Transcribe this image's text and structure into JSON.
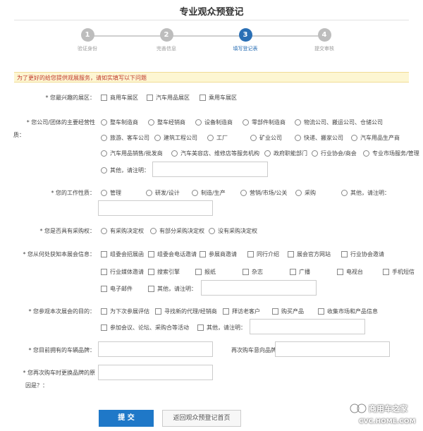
{
  "title": "专业观众预登记",
  "steps": [
    {
      "num": "1",
      "label": "验证身份"
    },
    {
      "num": "2",
      "label": "完善信息"
    },
    {
      "num": "3",
      "label": "填写登记表"
    },
    {
      "num": "4",
      "label": "提交审核"
    }
  ],
  "notice": "为了更好的给您提供观展服务，请如实填写以下问题",
  "q1": {
    "label": "* 您最兴趣的展区：",
    "options": [
      "商用车展区",
      "汽车用品展区",
      "乘用车展区"
    ]
  },
  "q2": {
    "label1": "* 您公司/团体的主要经营性",
    "label2": "质：",
    "row1": [
      "整车制造商",
      "整车经销商",
      "设备制造商",
      "零部件制造商",
      "物流公司、搬运公司、仓储公司"
    ],
    "row2": [
      "旅游、客车公司",
      "建筑工程公司",
      "工厂",
      "矿业公司",
      "快递、搬家公司",
      "汽车用品生产商"
    ],
    "row3": [
      "汽车用品销售/批发商",
      "汽车美容店、维修店等服务机构",
      "政府职能部门",
      "行业协会/商会",
      "专业市场服务/管理"
    ],
    "other": "其他，请注明："
  },
  "q3": {
    "label": "* 您的工作性质：",
    "options": [
      "管理",
      "研发/设计",
      "制造/生产",
      "营销/市场/公关",
      "采购"
    ],
    "other": "其他，请注明："
  },
  "q4": {
    "label": "* 您是否具有采购权：",
    "options": [
      "有采购决定权",
      "有部分采购决定权",
      "没有采购决定权"
    ]
  },
  "q5": {
    "label": "* 您从何处获知本展会信息：",
    "row1": [
      "组委会招展函",
      "组委会电话邀请",
      "参展商邀请",
      "同行介绍",
      "展会官方网站",
      "行业协会邀请"
    ],
    "row2": [
      "行业媒体邀请",
      "搜索引擎",
      "报纸",
      "杂志",
      "广播",
      "电视台",
      "手机短信"
    ],
    "row3": [
      "电子邮件"
    ],
    "other": "其他，请注明："
  },
  "q6": {
    "label": "* 您参观本次展会的目的：",
    "row1": [
      "为下次参展评估",
      "寻找新的代理/经销商",
      "拜访老客户",
      "购买产品",
      "收集市场和产品信息"
    ],
    "row2": [
      "参加会议、论坛、采购合等活动"
    ],
    "other": "其他，请注明："
  },
  "q7": {
    "label": "* 您目前拥有的车辆品牌：",
    "label_b": "再次购车意向品牌："
  },
  "q8": {
    "label1": "* 您再次购车时更换品牌的原",
    "label2": "因是？："
  },
  "buttons": {
    "submit": "提 交",
    "back": "返回观众预登记首页"
  },
  "watermark": {
    "brand": "商用车之家",
    "url": "CVC.HOME.COM"
  }
}
